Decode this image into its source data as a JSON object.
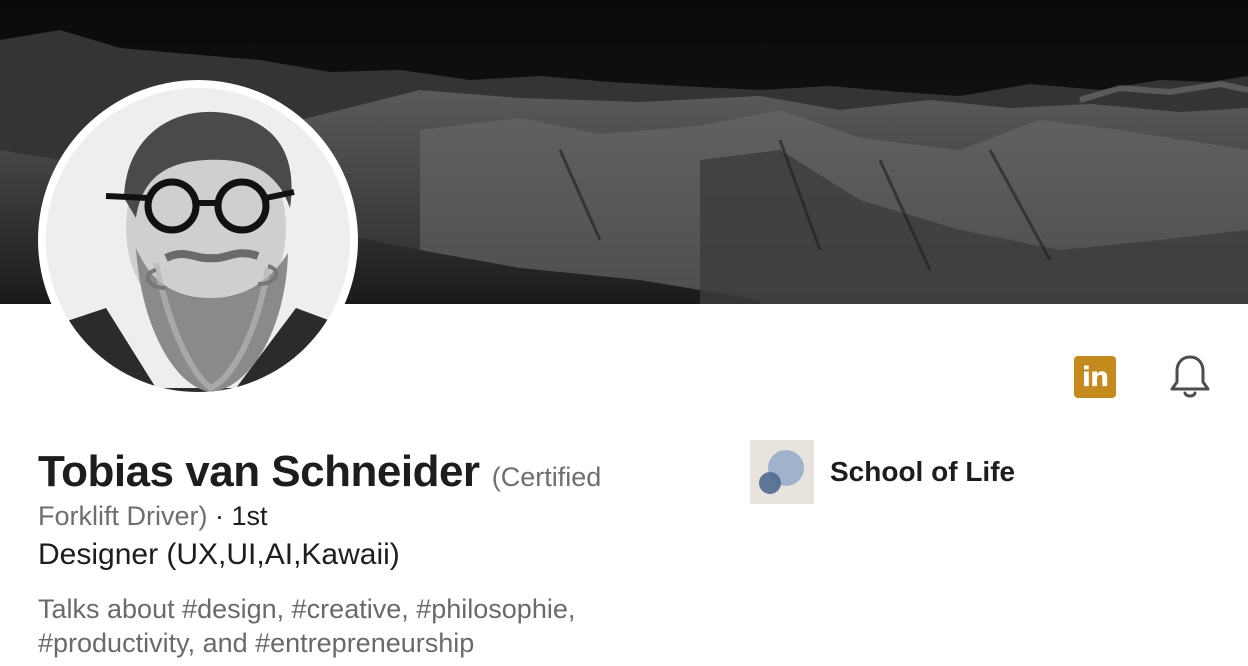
{
  "profile": {
    "name": "Tobias van Schneider",
    "pronoun_part1": "(Certified",
    "pronoun_part2": "Forklift Driver)",
    "degree": " · 1st",
    "headline": "Designer (UX,UI,AI,Kawaii)",
    "talks_line1": "Talks about #design, #creative, #philosophie,",
    "talks_line2": "#productivity, and #entrepreneurship"
  },
  "education": {
    "school_name": "School of Life"
  },
  "actions": {
    "linkedin_icon_text": "in",
    "linkedin_icon": "linkedin-icon",
    "bell_icon": "bell-icon"
  },
  "colors": {
    "linkedin_accent": "#c58a1c",
    "cover_bg": "#0d0d0d",
    "secondary_text": "#6e6e6e"
  }
}
